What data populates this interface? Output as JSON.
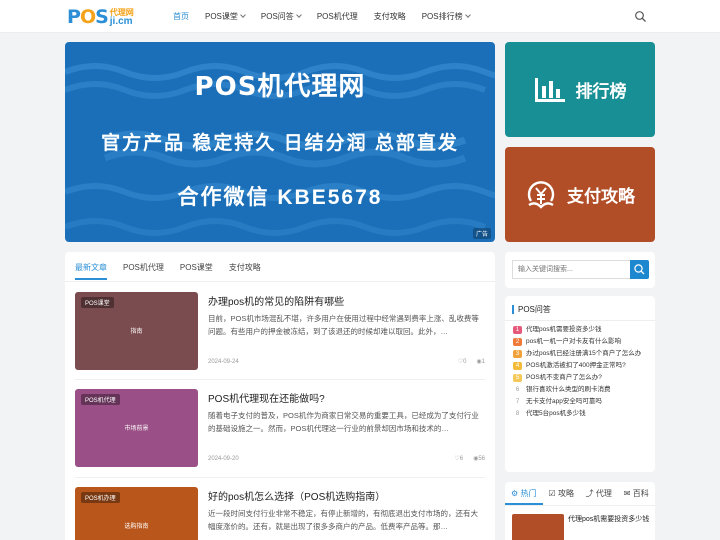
{
  "logo": {
    "text_pos": "POS",
    "text_top": "代理网",
    "text_domain": "ji.cm"
  },
  "nav": {
    "items": [
      {
        "label": "首页",
        "active": true,
        "dropdown": false
      },
      {
        "label": "POS课堂",
        "active": false,
        "dropdown": true
      },
      {
        "label": "POS问答",
        "active": false,
        "dropdown": true
      },
      {
        "label": "POS机代理",
        "active": false,
        "dropdown": false
      },
      {
        "label": "支付攻略",
        "active": false,
        "dropdown": false
      },
      {
        "label": "POS排行榜",
        "active": false,
        "dropdown": true
      }
    ],
    "search_icon": "search-icon"
  },
  "banner": {
    "title": "POS机代理网",
    "subtitle": "官方产品 稳定持久 日结分润 总部直发",
    "contact": "合作微信 KBE5678",
    "ad_label": "广告",
    "bg_color": "#1b6fb8"
  },
  "side_cards": [
    {
      "label": "排行榜",
      "icon": "bar-chart-icon",
      "color": "#188f94"
    },
    {
      "label": "支付攻略",
      "icon": "yen-coin-icon",
      "color": "#b24e27"
    }
  ],
  "tabs": [
    "最新文章",
    "POS机代理",
    "POS课堂",
    "支付攻略"
  ],
  "posts": [
    {
      "tag": "POS课堂",
      "thumb_title": "指南",
      "thumb_color": "#7a4b4f",
      "title": "办理pos机的常见的陷阱有哪些",
      "excerpt": "目前，POS机市场混乱不堪，许多用户在使用过程中经常遇到费率上涨、乱收费等问题。有些用户的押金被冻结，到了该退还的时候却难以取回。此外，…",
      "date": "2024-09-24",
      "likes": "0",
      "views": "1"
    },
    {
      "tag": "POS机代理",
      "thumb_title": "市场前景",
      "thumb_color": "#9a4f86",
      "title": "POS机代理现在还能做吗?",
      "excerpt": "随着电子支付的普及，POS机作为商家日常交易的重要工具，已经成为了支付行业的基础设施之一。然而，POS机代理这一行业的前景却因市场和技术的…",
      "date": "2024-09-20",
      "likes": "6",
      "views": "56"
    },
    {
      "tag": "POS机办理",
      "thumb_title": "选购指南",
      "thumb_color": "#b8561b",
      "title": "好的pos机怎么选择（POS机选购指南）",
      "excerpt": "近一段时间支付行业非常不稳定，有停止新增的，有彻底退出支付市场的，还有大幅度涨价的。还有，就是出现了很多多商户的产品。低费率产品等。那…",
      "date": "",
      "likes": "",
      "views": ""
    }
  ],
  "search": {
    "placeholder": "输入关键词搜索..."
  },
  "qa": {
    "heading": "POS问答",
    "items": [
      {
        "n": "1",
        "text": "代理pos机需要投资多少钱",
        "color": "#e55a7b"
      },
      {
        "n": "2",
        "text": "pos机一机一户对卡友有什么影响",
        "color": "#f07a3a"
      },
      {
        "n": "3",
        "text": "办过pos机已经注册满15个商户了怎么办",
        "color": "#f0a13a"
      },
      {
        "n": "4",
        "text": "POS机激活被扣了400押金正常吗?",
        "color": "#f3bb3a"
      },
      {
        "n": "5",
        "text": "POS机不变商户了怎么办?",
        "color": "#f5c85a"
      },
      {
        "n": "6",
        "text": "银行喜欢什么类型的刷卡消费",
        "color": ""
      },
      {
        "n": "7",
        "text": "无卡支付app安全吗可靠吗",
        "color": ""
      },
      {
        "n": "8",
        "text": "代理5台pos机多少钱",
        "color": ""
      }
    ]
  },
  "hot": {
    "tabs": [
      {
        "label": "热门",
        "icon": "gear-icon",
        "active": true
      },
      {
        "label": "攻略",
        "icon": "check-square-icon",
        "active": false
      },
      {
        "label": "代理",
        "icon": "share-icon",
        "active": false
      },
      {
        "label": "百科",
        "icon": "chat-icon",
        "active": false
      }
    ],
    "first_title": "代理pos机需要投资多少钱"
  }
}
